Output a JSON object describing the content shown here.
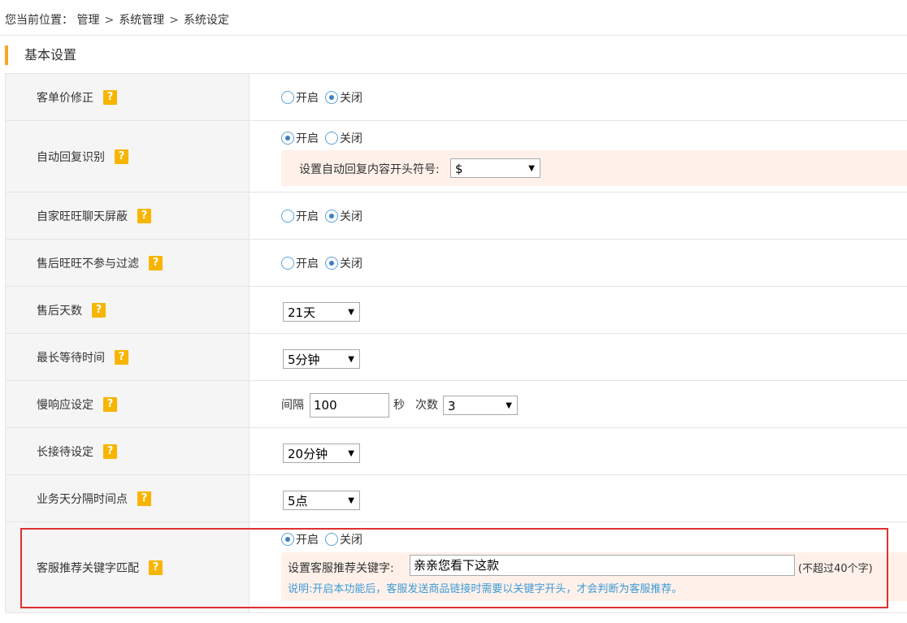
{
  "breadcrumb": {
    "prefix": "您当前位置：",
    "items": [
      "管理",
      "系统管理",
      "系统设定"
    ],
    "separator": ">"
  },
  "section": {
    "title": "基本设置"
  },
  "help_glyph": "?",
  "radio_labels": {
    "on": "开启",
    "off": "关闭"
  },
  "rows": [
    {
      "label": "客单价修正",
      "enabled": false
    },
    {
      "label": "自动回复识别",
      "enabled": true,
      "sub_label": "设置自动回复内容开头符号:",
      "select_value": "$"
    },
    {
      "label": "自家旺旺聊天屏蔽",
      "enabled": false
    },
    {
      "label": "售后旺旺不参与过滤",
      "enabled": false
    },
    {
      "label": "售后天数",
      "select_value": "21天"
    },
    {
      "label": "最长等待时间",
      "select_value": "5分钟"
    },
    {
      "label": "慢响应设定",
      "interval_label": "间隔",
      "interval_value": "100",
      "seconds_label": "秒",
      "count_label": "次数",
      "count_value": "3"
    },
    {
      "label": "长接待设定",
      "select_value": "20分钟"
    },
    {
      "label": "业务天分隔时间点",
      "select_value": "5点"
    },
    {
      "label": "客服推荐关键字匹配",
      "enabled": true,
      "sub_label": "设置客服推荐关键字:",
      "keyword_value": "亲亲您看下这款",
      "limit_note": "(不超过40个字)",
      "explanation": "说明:开启本功能后，客服发送商品链接时需要以关键字开头，才会判断为客服推荐。"
    }
  ],
  "colors": {
    "accent_bar": "#f5a623",
    "help_icon": "#f8b500",
    "highlight_border": "#e03030",
    "panel_bg": "#fff1ea",
    "note_text": "#3d9ad6"
  },
  "icons": {
    "help": "question-mark-icon",
    "select_arrow": "triangle-down-icon"
  }
}
